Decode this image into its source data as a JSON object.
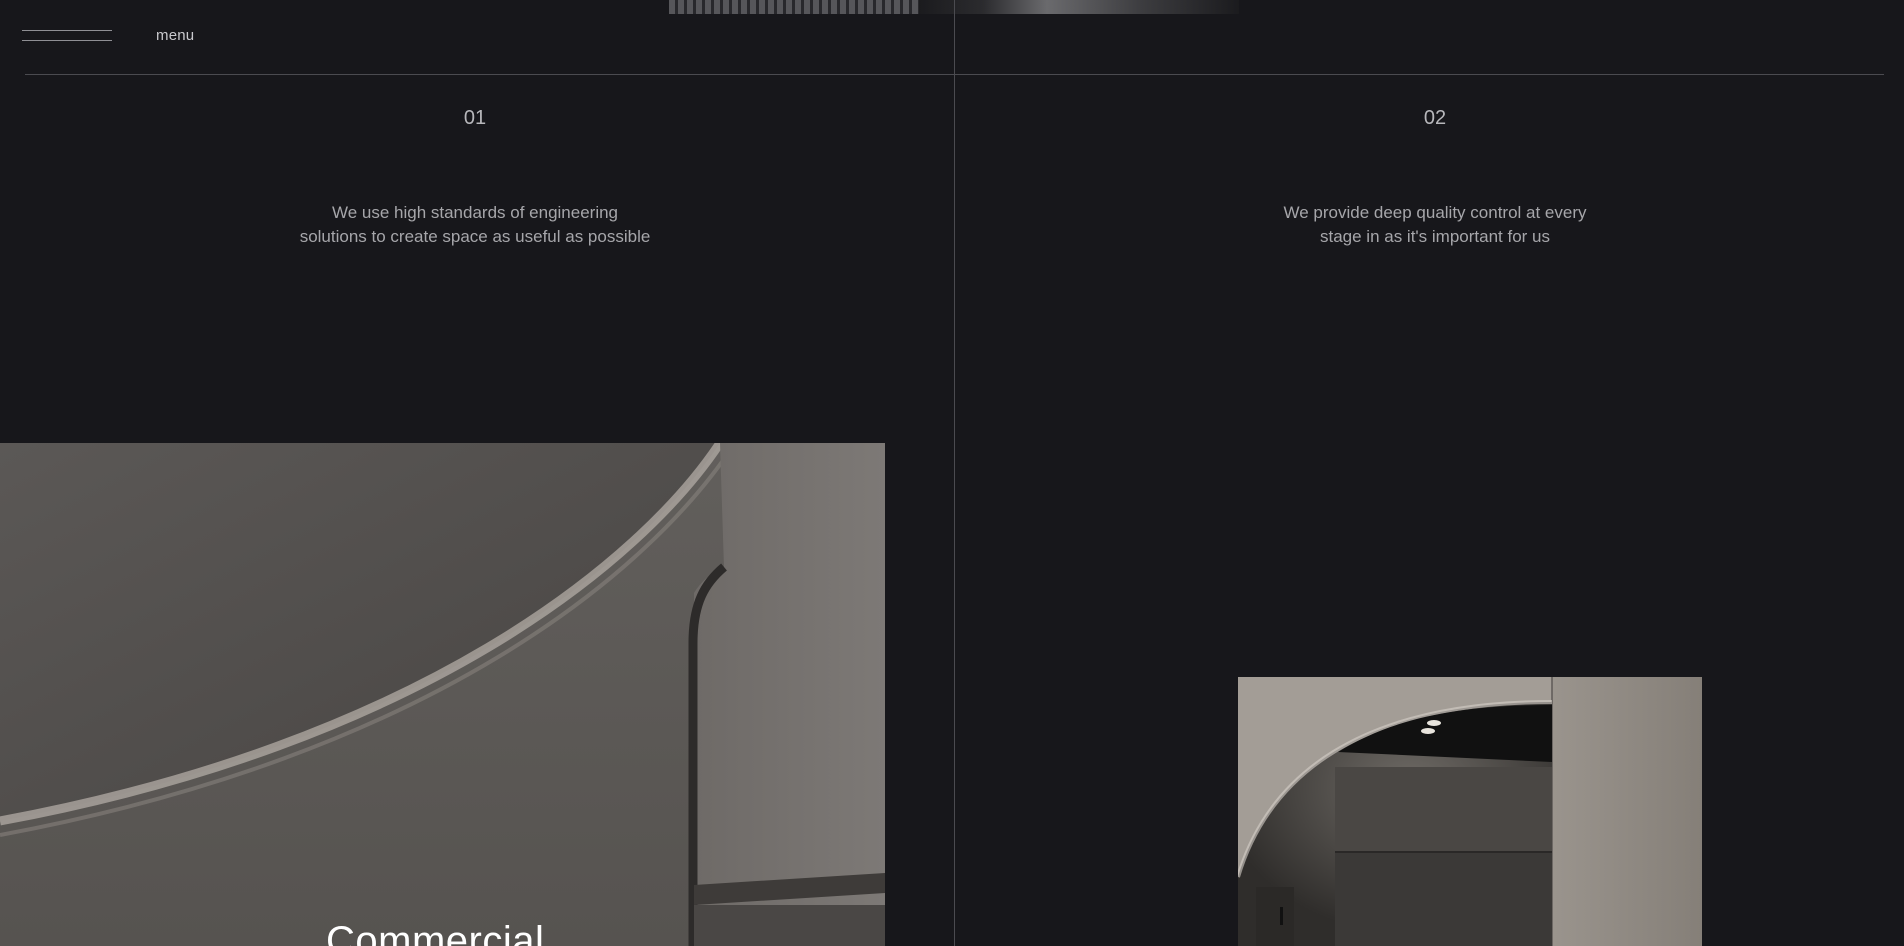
{
  "header": {
    "menu_label": "menu"
  },
  "columns": [
    {
      "number": "01",
      "text_line_1": "We use high standards of engineering",
      "text_line_2": "solutions to create space as useful as possible"
    },
    {
      "number": "02",
      "text_line_1": "We provide deep quality control at every",
      "text_line_2": "stage in as it's important for us"
    }
  ],
  "featured": {
    "category_title": "Commercial"
  },
  "colors": {
    "background": "#17171b",
    "rule": "#4b4b50",
    "text": "#a6a6aa",
    "title": "#ffffff"
  }
}
